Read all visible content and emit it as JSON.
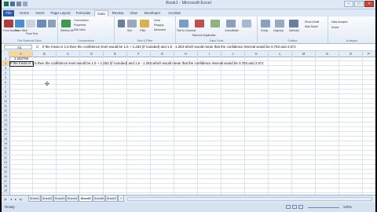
{
  "window": {
    "title": "Book1 - Microsoft Excel",
    "controls": [
      "–",
      "□",
      "×"
    ]
  },
  "tabs": [
    "File",
    "Home",
    "Insert",
    "Page Layout",
    "Formulas",
    "Data",
    "Review",
    "View",
    "Developer",
    "Acrobat"
  ],
  "active_tab": "Data",
  "ribbon_groups": [
    {
      "name": "Get External Data",
      "items": [
        "From Access",
        "From Web",
        "From Text",
        "From Other Sources",
        "Existing Connections"
      ]
    },
    {
      "name": "Connections",
      "items": [
        "Refresh All",
        "Connections",
        "Properties",
        "Edit Links"
      ]
    },
    {
      "name": "Sort & Filter",
      "items": [
        "Sort",
        "Filter",
        "Clear",
        "Reapply",
        "Advanced"
      ]
    },
    {
      "name": "Data Tools",
      "items": [
        "Text to Columns",
        "Remove Duplicates",
        "Data Validation",
        "Consolidate",
        "What-If Analysis"
      ]
    },
    {
      "name": "Outline",
      "items": [
        "Group",
        "Ungroup",
        "Subtotal",
        "Show Detail",
        "Hide Detail"
      ]
    },
    {
      "name": "Analysis",
      "items": [
        "Data Analysis",
        "Solver"
      ]
    }
  ],
  "formula_bar": {
    "name_box": "A2",
    "fx": "fx",
    "content": "If the mean is 1.5 then the confidence level would be 1.5 + 1.253 (if rounded) and 1.5 - 1.253 which would mean that the confidence interval would be 0.753 and 2.571"
  },
  "columns": [
    "A",
    "B",
    "C",
    "D",
    "E",
    "F",
    "G",
    "H",
    "I",
    "J",
    "K",
    "L",
    "M",
    "N",
    "O",
    "P"
  ],
  "rows": [
    "1",
    "2",
    "3",
    "4",
    "5",
    "6",
    "7",
    "8",
    "9",
    "10",
    "11",
    "12",
    "13",
    "14",
    "15",
    "16",
    "17",
    "18",
    "19",
    "20",
    "21",
    "22",
    "23",
    "24",
    "25",
    "26",
    "27",
    "28",
    "29"
  ],
  "cells": {
    "A1": "1.253765",
    "A2": "If the mean is 1.5 then the confidence level would be 1.5 + 1.253 (if rounded) and 1.5 - 1.253 which would mean that the confidence interval would be 0.753 and 2.571"
  },
  "sheet_tabs": [
    "Sheet1",
    "Sheet2",
    "Sheet3",
    "Sheet4",
    "Sheet5",
    "Sheet6",
    "Sheet7"
  ],
  "active_sheet": "Sheet5",
  "status": {
    "ready": "Ready",
    "zoom": "100%"
  },
  "colors": {
    "file_tab": "#2a5aa8",
    "ribbon_bg": "#e3ebf6",
    "selected_header": "#f8d898"
  }
}
